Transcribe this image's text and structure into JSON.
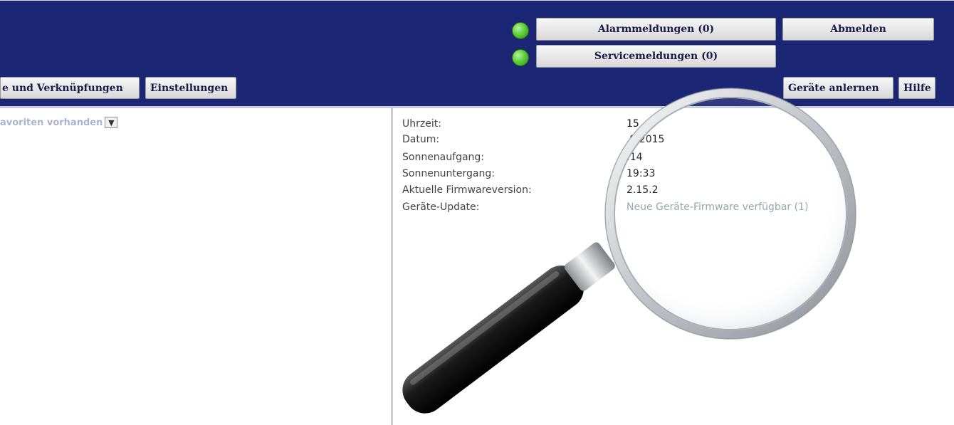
{
  "header": {
    "alarm_button": "Alarmmeldungen (0)",
    "service_button": "Servicemeldungen (0)",
    "logout_button": "Abmelden",
    "nav": {
      "links_button": "e und Verknüpfungen",
      "settings_button": "Einstellungen",
      "teach_button": "Geräte anlernen",
      "help_button": "Hilfe"
    },
    "status_color": "#5ed13a"
  },
  "favorites": {
    "selected": "avoriten vorhanden"
  },
  "info": {
    "rows": [
      {
        "label": "Uhrzeit:",
        "value": "15"
      },
      {
        "label": "Datum:",
        "value": ".9.2015"
      },
      {
        "label": "Sonnenaufgang:",
        "value": ":14"
      },
      {
        "label": "Sonnenuntergang:",
        "value": "19:33"
      },
      {
        "label": "Aktuelle Firmwareversion:",
        "value": "2.15.2"
      },
      {
        "label": "Geräte-Update:",
        "value": "Neue Geräte-Firmware verfügbar (1)"
      }
    ]
  },
  "colors": {
    "header_bg": "#1b2674",
    "link": "#8ea0a8"
  }
}
